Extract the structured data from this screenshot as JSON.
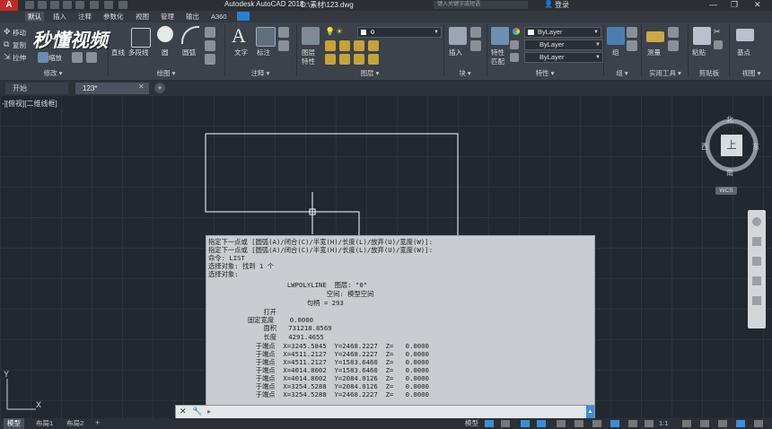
{
  "titlebar": {
    "app_name": "Autodesk AutoCAD 2018",
    "file_path": "D:\\素材\\123.dwg",
    "search_placeholder": "键入关键字或短语",
    "login_label": "登录",
    "minimize_glyph": "—",
    "restore_glyph": "❐",
    "close_glyph": "✕",
    "app_logo": "A"
  },
  "watermark": {
    "text": "秒懂视频"
  },
  "ribbon_tabs": [
    {
      "label": "默认",
      "active": true
    },
    {
      "label": "插入",
      "active": false
    },
    {
      "label": "注释",
      "active": false
    },
    {
      "label": "参数化",
      "active": false
    },
    {
      "label": "视图",
      "active": false
    },
    {
      "label": "管理",
      "active": false
    },
    {
      "label": "输出",
      "active": false
    },
    {
      "label": "A360",
      "active": false
    }
  ],
  "ribbon": {
    "modify": {
      "move": "移动",
      "copy": "复制",
      "stretch": "拉伸",
      "scale": "缩放",
      "title": "修改 ▾"
    },
    "draw": {
      "line": "直线",
      "polyline": "多段线",
      "circle": "圆",
      "arc": "圆弧",
      "title": "绘图 ▾"
    },
    "annotation": {
      "text": "文字",
      "dimension": "标注",
      "title": "注释 ▾"
    },
    "layers": {
      "layer_props_line1": "图层",
      "layer_props_line2": "特性",
      "layer_combo": "0",
      "title": "图层 ▾"
    },
    "block": {
      "insert": "插入",
      "title": "块 ▾"
    },
    "properties": {
      "match_line1": "特性",
      "match_line2": "匹配",
      "color_combo": "ByLayer",
      "linetype_combo": "ByLayer",
      "lineweight_combo": "ByLayer",
      "title": "特性 ▾"
    },
    "groups": {
      "group": "组",
      "title": "组 ▾"
    },
    "utilities": {
      "measure": "测量",
      "title": "实用工具 ▾"
    },
    "clipboard": {
      "paste": "粘贴",
      "title": "剪贴板"
    },
    "view": {
      "base": "基点",
      "title": "视图 ▾"
    }
  },
  "doc_tabs": [
    {
      "label": "开始"
    },
    {
      "label": "123*"
    }
  ],
  "doc_add_glyph": "+",
  "viewport_label": "-][俯视][二维线框]",
  "viewcube": {
    "north": "北",
    "south": "南",
    "east": "东",
    "west": "西",
    "top": "上",
    "wcs": "WCS"
  },
  "ucs": {
    "x": "X",
    "y": "Y"
  },
  "command_history": [
    "指定下一点或 [圆弧(A)/闭合(C)/半宽(H)/长度(L)/放弃(U)/宽度(W)]:",
    "指定下一点或 [圆弧(A)/闭合(C)/半宽(H)/长度(L)/放弃(U)/宽度(W)]:",
    "命令: LIST",
    "选择对象: 找到 1 个",
    "选择对象:",
    "                    LWPOLYLINE  图层: \"0\"",
    "                              空间: 模型空间",
    "                         句柄 = 293",
    "              打开",
    "          固定宽度    0.0000",
    "              面积   731218.8569",
    "              长度   4291.4655",
    "            于端点  X=3245.5845  Y=2468.2227  Z=   0.0000",
    "            于端点  X=4511.2127  Y=2468.2227  Z=   0.0000",
    "            于端点  X=4511.2127  Y=1583.6460  Z=   0.0000",
    "            于端点  X=4014.8002  Y=1583.6460  Z=   0.0000",
    "            于端点  X=4014.8002  Y=2084.0126  Z=   0.0000",
    "            于端点  X=3254.5288  Y=2084.0126  Z=   0.0000",
    "            于端点  X=3254.5288  Y=2468.2227  Z=   0.0000"
  ],
  "command_input": {
    "prompt": "▸ ",
    "value": ""
  },
  "status_tabs": [
    {
      "label": "模型",
      "active": true
    },
    {
      "label": "布局1",
      "active": false
    },
    {
      "label": "布局2",
      "active": false
    }
  ],
  "status_right": {
    "model_label": "模型",
    "scale": "1:1"
  }
}
